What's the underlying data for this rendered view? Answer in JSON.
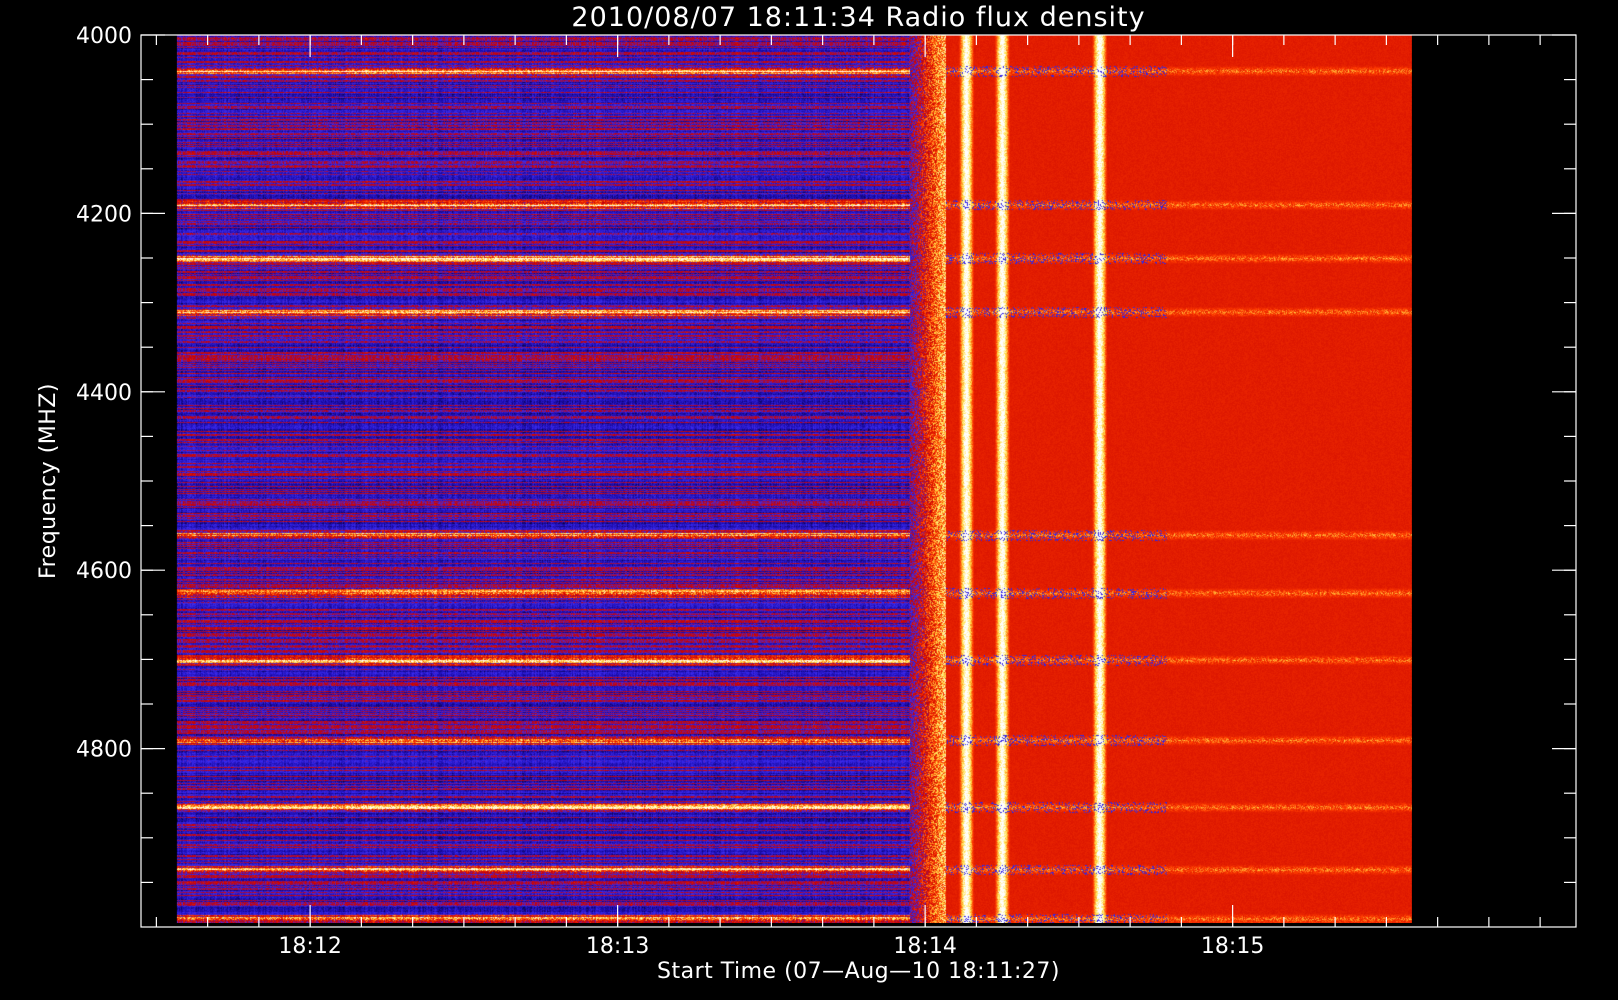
{
  "chart_data": {
    "type": "heatmap",
    "title": "2010/08/07 18:11:34 Radio flux density",
    "xlabel": "Start Time (07—Aug—10 18:11:27)",
    "ylabel": "Frequency (MHZ)",
    "x_axis": {
      "unit": "seconds after 18:11:27",
      "range": [
        0,
        280
      ],
      "major_ticks": [
        {
          "value": 33,
          "label": "18:12"
        },
        {
          "value": 93,
          "label": "18:13"
        },
        {
          "value": 153,
          "label": "18:14"
        },
        {
          "value": 213,
          "label": "18:15"
        }
      ],
      "minor_tick_step": 10
    },
    "y_axis": {
      "unit": "MHz",
      "range": [
        4000,
        5000
      ],
      "inverted": true,
      "major_ticks": [
        {
          "value": 4000,
          "label": "4000"
        },
        {
          "value": 4200,
          "label": "4200"
        },
        {
          "value": 4400,
          "label": "4400"
        },
        {
          "value": 4600,
          "label": "4600"
        },
        {
          "value": 4800,
          "label": "4800"
        }
      ],
      "minor_tick_step": 50
    },
    "data_extent": {
      "time": [
        7,
        248
      ],
      "frequency": [
        4000,
        4995
      ]
    },
    "colormap": [
      "#000000",
      "#1a0aa8",
      "#3b2cf2",
      "#c80000",
      "#ff3c00",
      "#ffe14a",
      "#ffffff"
    ],
    "regions": [
      {
        "name": "pre-burst background",
        "time": [
          7,
          150
        ],
        "level": "low"
      },
      {
        "name": "burst onset",
        "time": [
          150,
          157
        ],
        "level": "mixed"
      },
      {
        "name": "burst",
        "time": [
          157,
          248
        ],
        "level": "high"
      }
    ],
    "bright_bands_mhz": [
      4040,
      4190,
      4250,
      4310,
      4560,
      4625,
      4700,
      4790,
      4865,
      4935,
      4990
    ],
    "bright_time_stripes_s": [
      161,
      168,
      187
    ]
  }
}
